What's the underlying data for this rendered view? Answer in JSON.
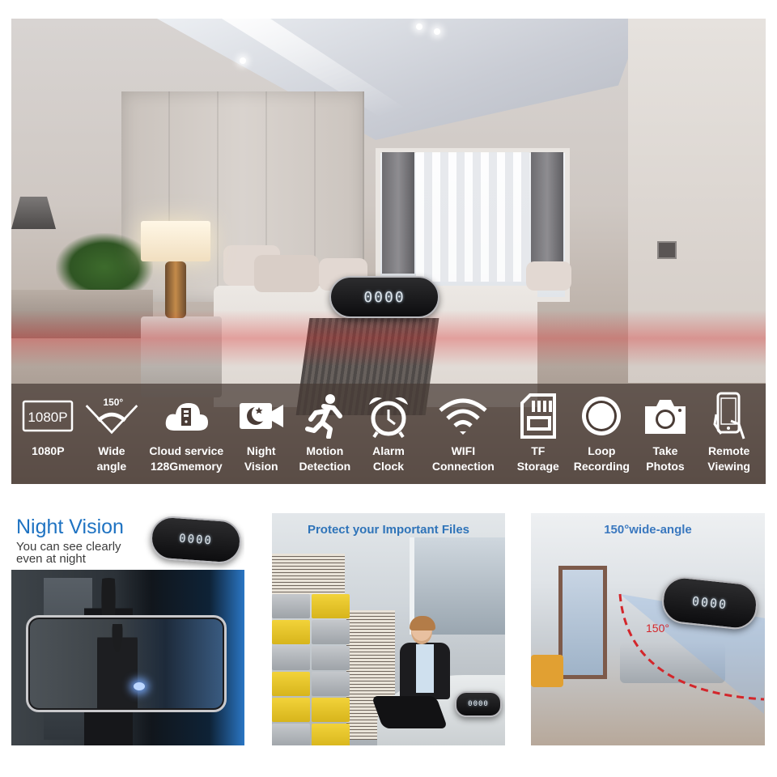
{
  "hero": {
    "scene": "bedroom-with-camera-clock",
    "clock_display": "0000",
    "features": [
      {
        "icon": "resolution-1080p-icon",
        "icon_text": "1080P",
        "label": "1080P"
      },
      {
        "icon": "wide-angle-icon",
        "icon_text": "150°",
        "label": "Wide\nangle"
      },
      {
        "icon": "cloud-storage-icon",
        "icon_text": "",
        "label": "Cloud service\n128Gmemory"
      },
      {
        "icon": "night-vision-camera-icon",
        "icon_text": "",
        "label": "Night\nVision"
      },
      {
        "icon": "running-person-icon",
        "icon_text": "",
        "label": "Motion\nDetection"
      },
      {
        "icon": "alarm-clock-icon",
        "icon_text": "",
        "label": "Alarm\nClock"
      },
      {
        "icon": "wifi-icon",
        "icon_text": "",
        "label": "WIFI\nConnection"
      },
      {
        "icon": "sd-card-icon",
        "icon_text": "",
        "label": "TF\nStorage"
      },
      {
        "icon": "record-loop-icon",
        "icon_text": "",
        "label": "Loop\nRecording"
      },
      {
        "icon": "camera-icon",
        "icon_text": "",
        "label": "Take\nPhotos"
      },
      {
        "icon": "smartphone-hand-icon",
        "icon_text": "",
        "label": "Remote\nViewing"
      }
    ]
  },
  "panels": {
    "night_vision": {
      "title": "Night Vision",
      "subtitle": "You can see clearly\neven at night",
      "clock_display": "0000"
    },
    "protect_files": {
      "title": "Protect your Important Files",
      "clock_display": "0000"
    },
    "wide_angle": {
      "title": "150°wide-angle",
      "angle_label": "150°",
      "clock_display": "0000"
    }
  },
  "colors": {
    "title_blue": "#1f73c2",
    "accent_red": "#d3262b",
    "strip_bg": "#463a34",
    "strip_text": "#ffffff"
  }
}
